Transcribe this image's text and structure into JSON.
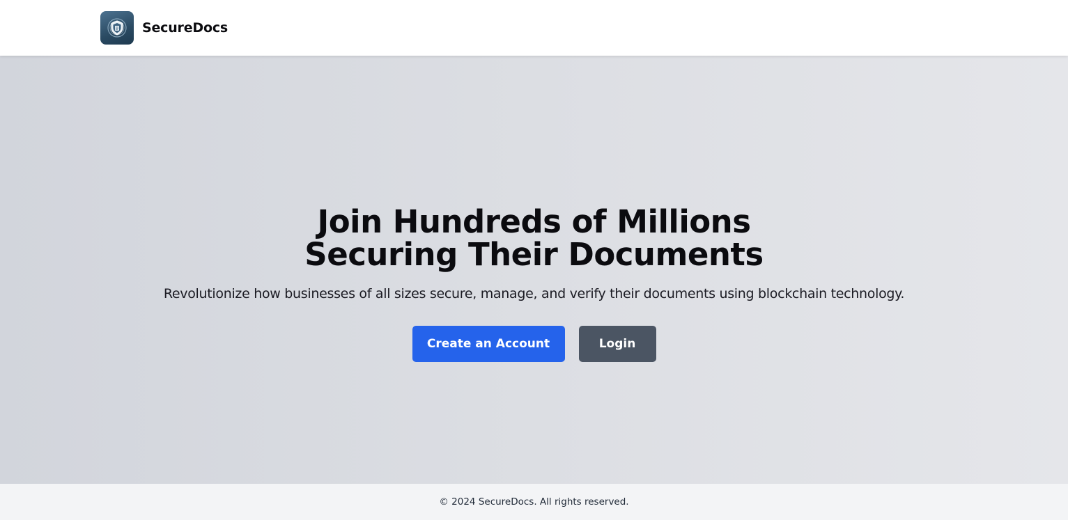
{
  "header": {
    "brand_name": "SecureDocs",
    "logo_icon": "shield-document-logo"
  },
  "hero": {
    "title_line1": "Join Hundreds of Millions",
    "title_line2": "Securing Their Documents",
    "subtitle": "Revolutionize how businesses of all sizes secure, manage, and verify their documents using blockchain technology.",
    "primary_button": "Create an Account",
    "secondary_button": "Login"
  },
  "footer": {
    "copyright": "© 2024 SecureDocs. All rights reserved."
  },
  "colors": {
    "primary": "#2563eb",
    "secondary": "#4b5563",
    "footer_bg": "#f3f4f6",
    "hero_bg_start": "#d2d5dc",
    "hero_bg_end": "#e5e6ea"
  }
}
